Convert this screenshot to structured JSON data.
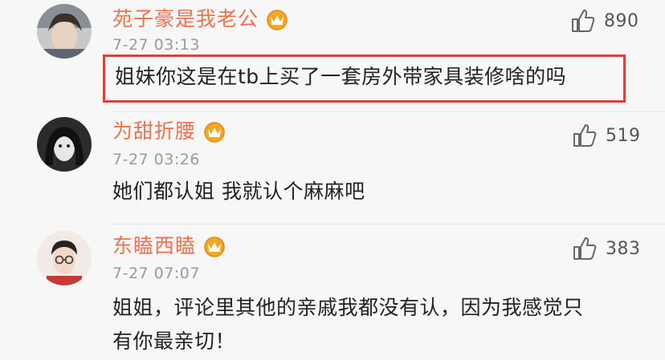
{
  "comments": [
    {
      "username": "苑子豪是我老公",
      "time": "7-27 03:13",
      "text": "姐妹你这是在tb上买了一套房外带家具装修啥的吗",
      "likes": "890",
      "highlighted": true
    },
    {
      "username": "为甜折腰",
      "time": "7-27 03:26",
      "text": "她们都认姐 我就认个麻麻吧",
      "likes": "519",
      "highlighted": false
    },
    {
      "username": "东瞌西瞌",
      "time": "7-27 07:07",
      "text_line1": "姐姐，评论里其他的亲戚我都没有认，因为我感觉只",
      "text_line2": "有你最亲切！",
      "likes": "383",
      "highlighted": false
    }
  ],
  "colors": {
    "username": "#eb7350",
    "highlight_border": "#d9413a",
    "background": "#f7f7f7",
    "crown_badge": "#f5a623"
  },
  "icons": {
    "badge": "crown-badge-icon",
    "like": "thumbs-up-icon"
  }
}
